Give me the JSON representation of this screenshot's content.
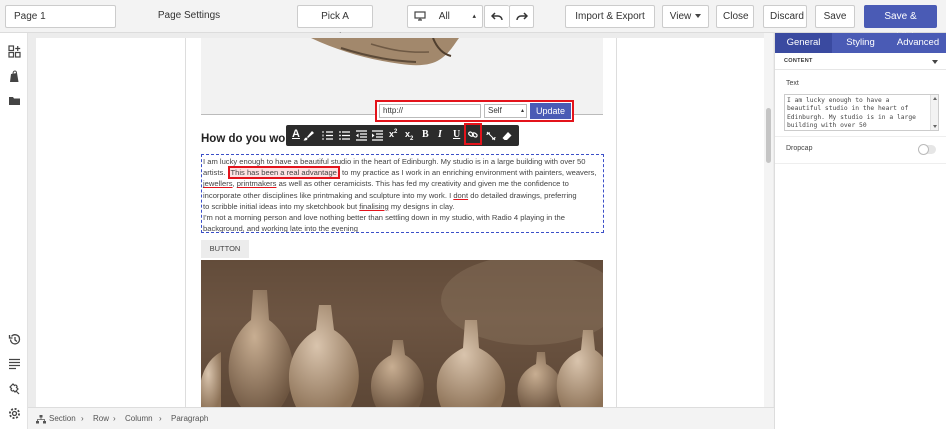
{
  "topbar": {
    "page_name": "Page 1",
    "page_settings_label": "Page Settings",
    "pick_template_label": "Pick A Template",
    "device_value": "All",
    "import_export_label": "Import & Export",
    "view_label": "View",
    "close_label": "Close",
    "discard_label": "Discard",
    "save_label": "Save",
    "save_publish_label": "Save & Publish"
  },
  "link_popup": {
    "url_value": "http://",
    "target_value": "Self",
    "update_label": "Update"
  },
  "content": {
    "heading": "How do you work?",
    "para_line1": "I am lucky enough to have a beautiful studio in the heart of Edinburgh. My studio is in a large building with over 50",
    "para_line2_a": "artists.",
    "para_line2_highlight": "This has been a real advantage",
    "para_line2_b": "to my practice as I work in an enriching environment with painters, weavers,",
    "para_line3_jewellers": "jewellers",
    "para_line3_printmakers": "printmakers",
    "para_line3_rest": "as well as other ceramicists. This has fed my creativity and given me the confidence to",
    "para_line4_a": "incorporate other disciplines like printmaking and sculpture into my work. I",
    "para_line4_dont": "dont",
    "para_line4_b": "do detailed drawings, preferring",
    "para_line5_a": "to scribble initial ideas into my sketchbook but",
    "para_line5_finalising": "finalising",
    "para_line5_b": "my designs in clay.",
    "para_line6": "I'm not a morning person and love nothing better than settling down in my studio, with Radio 4 playing in the",
    "para_line7": "background, and working late into the evening",
    "button_label": "BUTTON"
  },
  "format_toolbar": {
    "items": [
      "A",
      "I",
      "U"
    ]
  },
  "breadcrumb": [
    "Section",
    "Row",
    "Column",
    "Paragraph"
  ],
  "right_panel": {
    "tabs": [
      "General",
      "Styling",
      "Advanced"
    ],
    "section_title": "CONTENT",
    "text_label": "Text",
    "text_value": "I am lucky enough to have a beautiful studio in the heart of Edinburgh. My studio is in a large building with over 50",
    "dropcap_label": "Dropcap"
  },
  "colors": {
    "accent": "#4a5bb5",
    "highlight_border": "#e3131b",
    "selection_dash": "#3b4fc8"
  }
}
